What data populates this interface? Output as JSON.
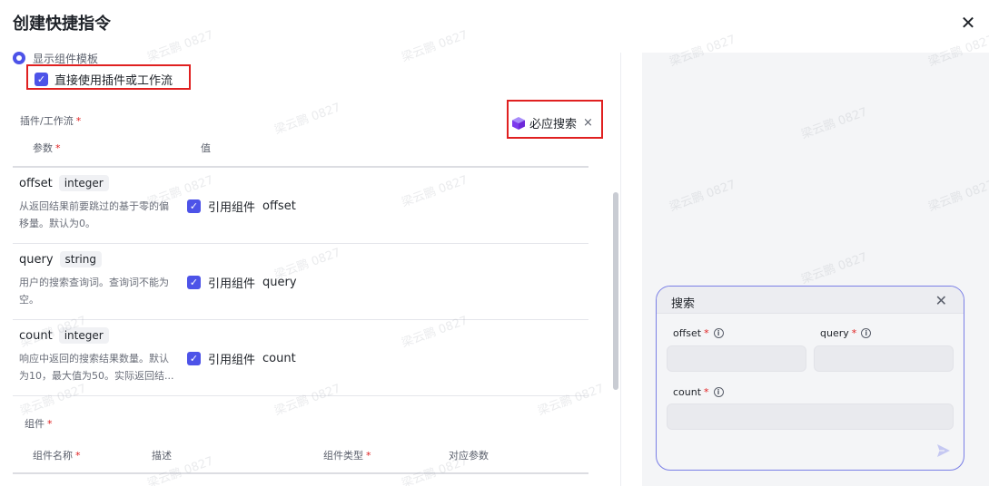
{
  "dialog": {
    "title": "创建快捷指令",
    "close_icon": "close-icon"
  },
  "template_option": {
    "label": "显示组件模板"
  },
  "direct_option": {
    "label": "直接使用插件或工作流",
    "checked": true
  },
  "plugin_section": {
    "label": "插件/工作流",
    "required_mark": "*"
  },
  "plugin_tag": {
    "icon": "cube-icon",
    "name": "必应搜索",
    "close": "×"
  },
  "params_header": {
    "param": "参数",
    "required_mark": "*",
    "value": "值"
  },
  "params": [
    {
      "name": "offset",
      "type": "integer",
      "desc": "从返回结果前要跳过的基于零的偏移量。默认为0。",
      "ref_label": "引用组件",
      "ref_value": "offset",
      "checked": true
    },
    {
      "name": "query",
      "type": "string",
      "desc": "用户的搜索查询词。查询词不能为空。",
      "ref_label": "引用组件",
      "ref_value": "query",
      "checked": true
    },
    {
      "name": "count",
      "type": "integer",
      "desc": "响应中返回的搜索结果数量。默认为10，最大值为50。实际返回结...",
      "ref_label": "引用组件",
      "ref_value": "count",
      "checked": true
    }
  ],
  "component_section": {
    "label": "组件",
    "required_mark": "*"
  },
  "component_header": {
    "name": "组件名称",
    "name_required": "*",
    "desc": "描述",
    "type": "组件类型",
    "type_required": "*",
    "param": "对应参数"
  },
  "preview": {
    "title": "搜索",
    "fields": [
      {
        "label": "offset",
        "required_mark": "*"
      },
      {
        "label": "query",
        "required_mark": "*"
      },
      {
        "label": "count",
        "required_mark": "*"
      }
    ],
    "info_glyph": "i"
  },
  "watermark": "梁云鹏 0827",
  "colors": {
    "accent": "#4d53e8",
    "highlight": "#e02020",
    "card_border": "#7a7fe6"
  }
}
